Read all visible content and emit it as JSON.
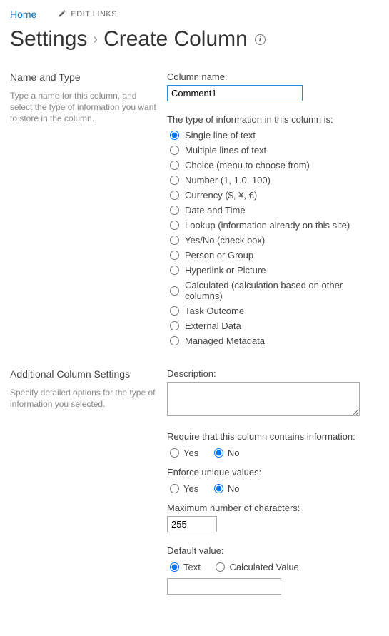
{
  "topnav": {
    "home": "Home",
    "edit_links": "EDIT LINKS"
  },
  "title": {
    "settings": "Settings",
    "separator": "›",
    "page": "Create Column",
    "info_glyph": "i"
  },
  "name_type": {
    "heading": "Name and Type",
    "description": "Type a name for this column, and select the type of information you want to store in the column.",
    "column_name_label": "Column name:",
    "column_name_value": "Comment1",
    "type_info_label": "The type of information in this column is:",
    "types": [
      "Single line of text",
      "Multiple lines of text",
      "Choice (menu to choose from)",
      "Number (1, 1.0, 100)",
      "Currency ($, ¥, €)",
      "Date and Time",
      "Lookup (information already on this site)",
      "Yes/No (check box)",
      "Person or Group",
      "Hyperlink or Picture",
      "Calculated (calculation based on other columns)",
      "Task Outcome",
      "External Data",
      "Managed Metadata"
    ],
    "selected_type_index": 0
  },
  "additional": {
    "heading": "Additional Column Settings",
    "description": "Specify detailed options for the type of information you selected.",
    "description_label": "Description:",
    "description_value": "",
    "require_label": "Require that this column contains information:",
    "require_yes": "Yes",
    "require_no": "No",
    "require_selected": "No",
    "unique_label": "Enforce unique values:",
    "unique_yes": "Yes",
    "unique_no": "No",
    "unique_selected": "No",
    "maxchars_label": "Maximum number of characters:",
    "maxchars_value": "255",
    "default_label": "Default value:",
    "default_text": "Text",
    "default_calc": "Calculated Value",
    "default_selected": "Text",
    "default_value": ""
  }
}
